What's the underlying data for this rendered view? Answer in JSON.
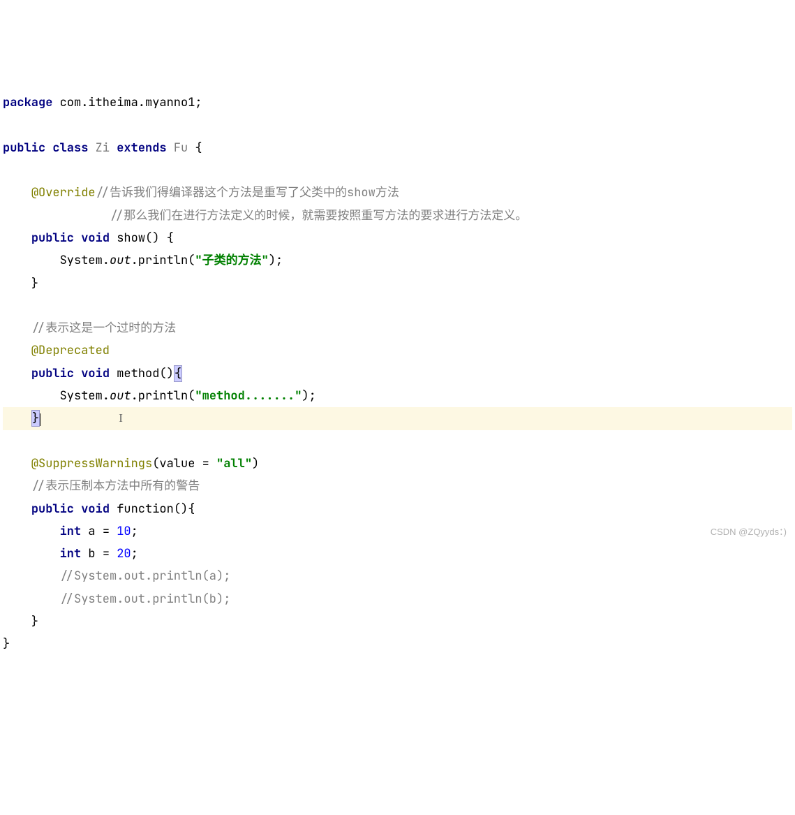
{
  "line1": {
    "kw_package": "package",
    "pkg_name": " com.itheima.myanno1;"
  },
  "line3": {
    "kw_public": "public",
    "kw_class": "class",
    "cls_zi": "Zi",
    "kw_extends": "extends",
    "cls_fu": "Fu",
    "brace": " {"
  },
  "line5": {
    "anno": "@Override",
    "comment": "//告诉我们得编译器这个方法是重写了父类中的show方法"
  },
  "line6": {
    "comment": "//那么我们在进行方法定义的时候，就需要按照重写方法的要求进行方法定义。"
  },
  "line7": {
    "kw_public": "public",
    "kw_void": "void",
    "method": " show() {"
  },
  "line8": {
    "indent": "        System.",
    "out": "out",
    "println": ".println(",
    "str": "\"子类的方法\"",
    "end": ");"
  },
  "line9": {
    "brace": "    }"
  },
  "line11": {
    "comment": "    //表示这是一个过时的方法"
  },
  "line12": {
    "anno": "    @Deprecated"
  },
  "line13": {
    "kw_public": "public",
    "kw_void": "void",
    "method": " method()",
    "brace": "{"
  },
  "line14": {
    "indent": "        System.",
    "out": "out",
    "println": ".println(",
    "str": "\"method.......\"",
    "end": ");"
  },
  "line15": {
    "brace": "}"
  },
  "line17": {
    "anno": "    @SuppressWarnings",
    "paren": "(value = ",
    "str": "\"all\"",
    "close": ")"
  },
  "line18": {
    "comment": "    //表示压制本方法中所有的警告"
  },
  "line19": {
    "kw_public": "public",
    "kw_void": "void",
    "method": " function(){"
  },
  "line20": {
    "kw_int": "int",
    "rest": " a = ",
    "num": "10",
    "semi": ";"
  },
  "line21": {
    "kw_int": "int",
    "rest": " b = ",
    "num": "20",
    "semi": ";"
  },
  "line22": {
    "comment": "        //System.out.println(a);"
  },
  "line23": {
    "comment": "        //System.out.println(b);"
  },
  "line24": {
    "brace": "    }"
  },
  "line25": {
    "brace": "}"
  },
  "watermark": "CSDN @ZQyyds：)"
}
